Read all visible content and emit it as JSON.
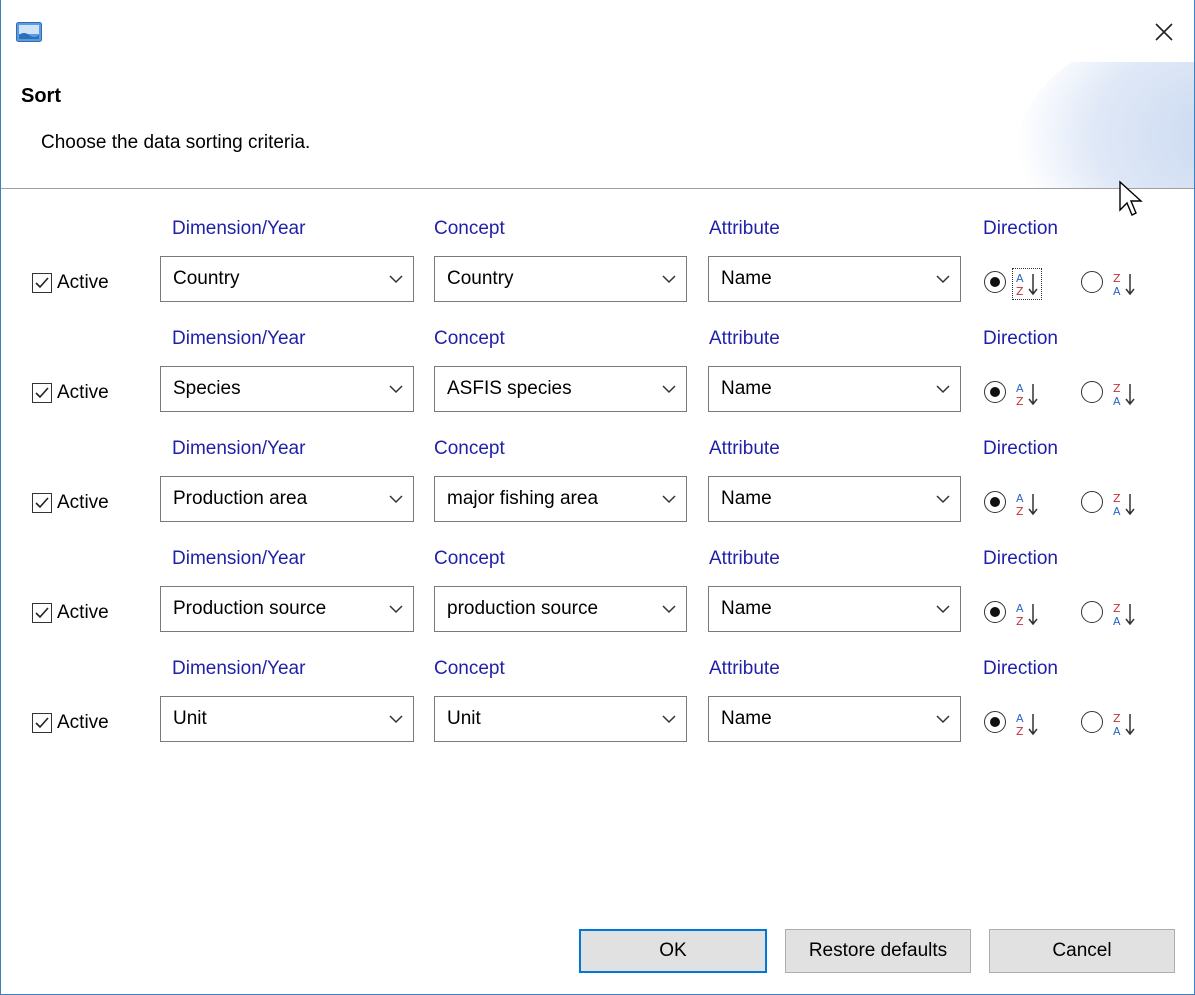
{
  "header": {
    "title": "Sort",
    "description": "Choose the data sorting criteria."
  },
  "columns": {
    "dimension": "Dimension/Year",
    "concept": "Concept",
    "attribute": "Attribute",
    "direction": "Direction"
  },
  "rows": [
    {
      "active_label": "Active",
      "active": true,
      "dimension": "Country",
      "concept": "Country",
      "attribute": "Name",
      "direction": "ascending"
    },
    {
      "active_label": "Active",
      "active": true,
      "dimension": "Species",
      "concept": "ASFIS species",
      "attribute": "Name",
      "direction": "ascending"
    },
    {
      "active_label": "Active",
      "active": true,
      "dimension": "Production area",
      "concept": "major fishing area",
      "attribute": "Name",
      "direction": "ascending"
    },
    {
      "active_label": "Active",
      "active": true,
      "dimension": "Production source",
      "concept": "production source",
      "attribute": "Name",
      "direction": "ascending"
    },
    {
      "active_label": "Active",
      "active": true,
      "dimension": "Unit",
      "concept": "Unit",
      "attribute": "Name",
      "direction": "ascending"
    }
  ],
  "icons": {
    "app": "app-icon",
    "close": "close-icon",
    "ascending": "sort-ascending-icon",
    "descending": "sort-descending-icon",
    "dropdown": "chevron-down-icon"
  },
  "colors": {
    "column_label": "#1f1fa8",
    "window_border": "#3c7fc2",
    "default_button_border": "#0078d7",
    "button_face": "#e1e1e1"
  },
  "buttons": {
    "ok": "OK",
    "restore": "Restore defaults",
    "cancel": "Cancel"
  }
}
